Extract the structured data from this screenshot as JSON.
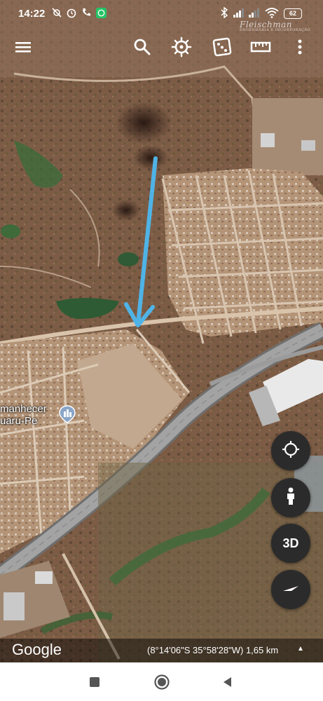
{
  "status_bar": {
    "time": "14:22",
    "battery": "62",
    "icons": [
      "location-off-icon",
      "alarm-icon",
      "phone-icon",
      "whatsapp-icon",
      "bluetooth-icon",
      "signal-icon",
      "wifi-icon",
      "battery-icon"
    ]
  },
  "watermark": {
    "name": "Fleischman",
    "subtitle": "ENGENHARIA E INCORPORAÇÃO"
  },
  "toolbar": {
    "icons": [
      "menu-icon",
      "search-icon",
      "voyager-icon",
      "random-dice-icon",
      "measure-icon",
      "more-icon"
    ]
  },
  "map": {
    "place_label_line1": "manhecer",
    "place_label_line2": "uaru-Pe",
    "arrow_color": "#4fb3e6"
  },
  "controls": {
    "compass_icon": "my-location-icon",
    "pegman_icon": "street-view-pegman-icon",
    "three_d_label": "3D",
    "north_icon": "compass-icon"
  },
  "map_bar": {
    "logo": "Google",
    "coordinates": "(8°14'06\"S 35°58'28\"W) 1,65 km",
    "caret": "▲"
  },
  "nav_bar": {
    "icons": [
      "recents-square-icon",
      "home-circle-icon",
      "back-triangle-icon"
    ]
  }
}
